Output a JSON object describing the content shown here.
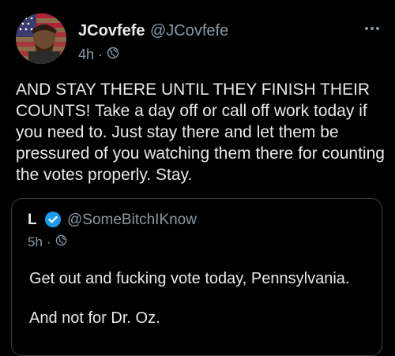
{
  "tweet": {
    "display_name": "JCovfefe",
    "handle": "@JCovfefe",
    "time": "4h",
    "separator": "·",
    "visibility_icon": "globe-icon",
    "text": "AND STAY THERE UNTIL THEY FINISH THEIR COUNTS! Take a day off or call off work today if you need to. Just stay there and let them be pressured of you watching them there for counting the votes properly. Stay."
  },
  "quoted": {
    "display_name": "L",
    "verified_icon": "verified-badge-icon",
    "handle": "@SomeBitchIKnow",
    "time": "5h",
    "separator": "·",
    "visibility_icon": "globe-icon",
    "line1": "Get out and fucking vote today, Pennsylvania.",
    "line2": "And not for Dr. Oz."
  },
  "colors": {
    "background": "#000000",
    "text": "#e7e9ea",
    "muted": "#8b98a5",
    "verified": "#1d9bf0",
    "border": "#3a3f44"
  }
}
